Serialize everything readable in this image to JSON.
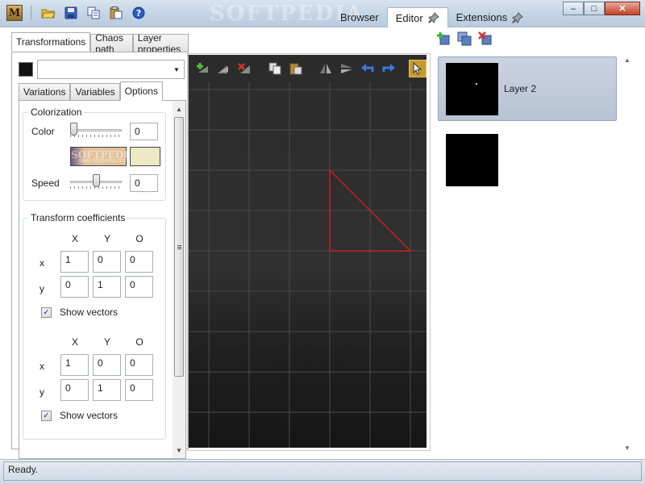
{
  "watermark": "SOFTPEDIA",
  "titlebar": {
    "app_icon_letter": "M",
    "quick_access": [
      "open-folder-icon",
      "save-icon",
      "copy-icon",
      "paste-icon",
      "help-icon"
    ]
  },
  "top_tabs": [
    {
      "label": "Browser",
      "active": false,
      "pinned": false
    },
    {
      "label": "Editor",
      "active": true,
      "pinned": true
    },
    {
      "label": "Extensions",
      "active": false,
      "pinned": true
    }
  ],
  "window_controls": {
    "minimize": "–",
    "maximize": "□",
    "close": "✕"
  },
  "left_panel": {
    "tabs": [
      "Transformations",
      "Chaos path",
      "Layer properties"
    ],
    "active_tab": "Transformations",
    "layer_combo_value": "",
    "sub_tabs": [
      "Variations",
      "Variables",
      "Options"
    ],
    "active_sub_tab": "Options",
    "colorization": {
      "title": "Colorization",
      "color_label": "Color",
      "color_value": "0",
      "color_slider_fraction": 0.0,
      "gradient_colors": [
        "#6d5a86",
        "#e3c29a",
        "#eee8c4"
      ],
      "speed_label": "Speed",
      "speed_value": "0",
      "speed_slider_fraction": 0.5,
      "swatch_watermark": "SOFTPEDIA",
      "swatch_watermark_url": "www.softpedia.com"
    },
    "transform_coefficients": {
      "title": "Transform coefficients",
      "blocks": [
        {
          "headers": [
            "X",
            "Y",
            "O"
          ],
          "rows": [
            {
              "label": "x",
              "values": [
                "1",
                "0",
                "0"
              ]
            },
            {
              "label": "y",
              "values": [
                "0",
                "1",
                "0"
              ]
            }
          ],
          "show_vectors_label": "Show vectors",
          "show_vectors_checked": true
        },
        {
          "headers": [
            "X",
            "Y",
            "O"
          ],
          "rows": [
            {
              "label": "x",
              "values": [
                "1",
                "0",
                "0"
              ]
            },
            {
              "label": "y",
              "values": [
                "0",
                "1",
                "0"
              ]
            }
          ],
          "show_vectors_label": "Show vectors",
          "show_vectors_checked": true
        }
      ]
    }
  },
  "canvas": {
    "toolbar": [
      "add-transform-icon",
      "duplicate-transform-icon",
      "delete-transform-icon",
      "copy-icon",
      "paste-icon",
      "flip-horizontal-icon",
      "flip-vertical-icon",
      "undo-icon",
      "redo-icon",
      "select-pointer-icon"
    ],
    "active_tool": "select-pointer-icon",
    "triangle_color": "#cc1f1f",
    "grid_color": "#4a4a4a"
  },
  "right_panel": {
    "toolbar": [
      "add-layer-icon",
      "duplicate-layer-icon",
      "delete-layer-icon"
    ],
    "layers": [
      {
        "name": "Layer 2",
        "selected": true
      },
      {
        "name": "",
        "selected": false
      }
    ]
  },
  "status": {
    "text": "Ready."
  }
}
